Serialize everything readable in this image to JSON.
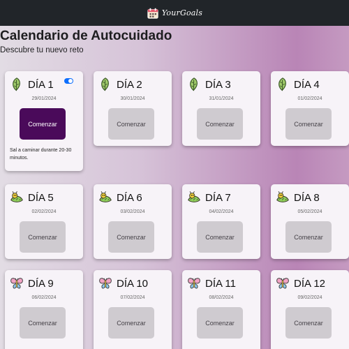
{
  "navbar": {
    "brand": "YourGoals",
    "logo_icon": "calendar-icon"
  },
  "header": {
    "title": "Calendario de Autocuidado",
    "subtitle": "Descubre tu nuevo reto"
  },
  "cards": [
    {
      "title": "DÍA 1",
      "date": "29/01/2024",
      "button": "Comenzar",
      "icon": "leaf-icon",
      "active": true,
      "toggle_on": true,
      "description": "Sal a caminar durante 20-30 minutos."
    },
    {
      "title": "DÍA 2",
      "date": "30/01/2024",
      "button": "Comenzar",
      "icon": "leaf-icon"
    },
    {
      "title": "DÍA 3",
      "date": "31/01/2024",
      "button": "Comenzar",
      "icon": "leaf-icon"
    },
    {
      "title": "DÍA 4",
      "date": "01/02/2024",
      "button": "Comenzar",
      "icon": "leaf-icon"
    },
    {
      "title": "DÍA 5",
      "date": "02/02/2024",
      "button": "Comenzar",
      "icon": "caterpillar-icon"
    },
    {
      "title": "DÍA 6",
      "date": "03/02/2024",
      "button": "Comenzar",
      "icon": "caterpillar-icon"
    },
    {
      "title": "DÍA 7",
      "date": "04/02/2024",
      "button": "Comenzar",
      "icon": "caterpillar-icon"
    },
    {
      "title": "DÍA 8",
      "date": "05/02/2024",
      "button": "Comenzar",
      "icon": "caterpillar-icon"
    },
    {
      "title": "DÍA 9",
      "date": "06/02/2024",
      "button": "Comenzar",
      "icon": "butterfly-icon"
    },
    {
      "title": "DÍA 10",
      "date": "07/02/2024",
      "button": "Comenzar",
      "icon": "butterfly-icon"
    },
    {
      "title": "DÍA 11",
      "date": "08/02/2024",
      "button": "Comenzar",
      "icon": "butterfly-icon"
    },
    {
      "title": "DÍA 12",
      "date": "09/02/2024",
      "button": "Comenzar",
      "icon": "butterfly-icon"
    }
  ],
  "colors": {
    "navbar": "#212529",
    "active_button": "#4a0a5a",
    "inactive_button": "#cfcbd0",
    "toggle": "#0d6efd"
  }
}
